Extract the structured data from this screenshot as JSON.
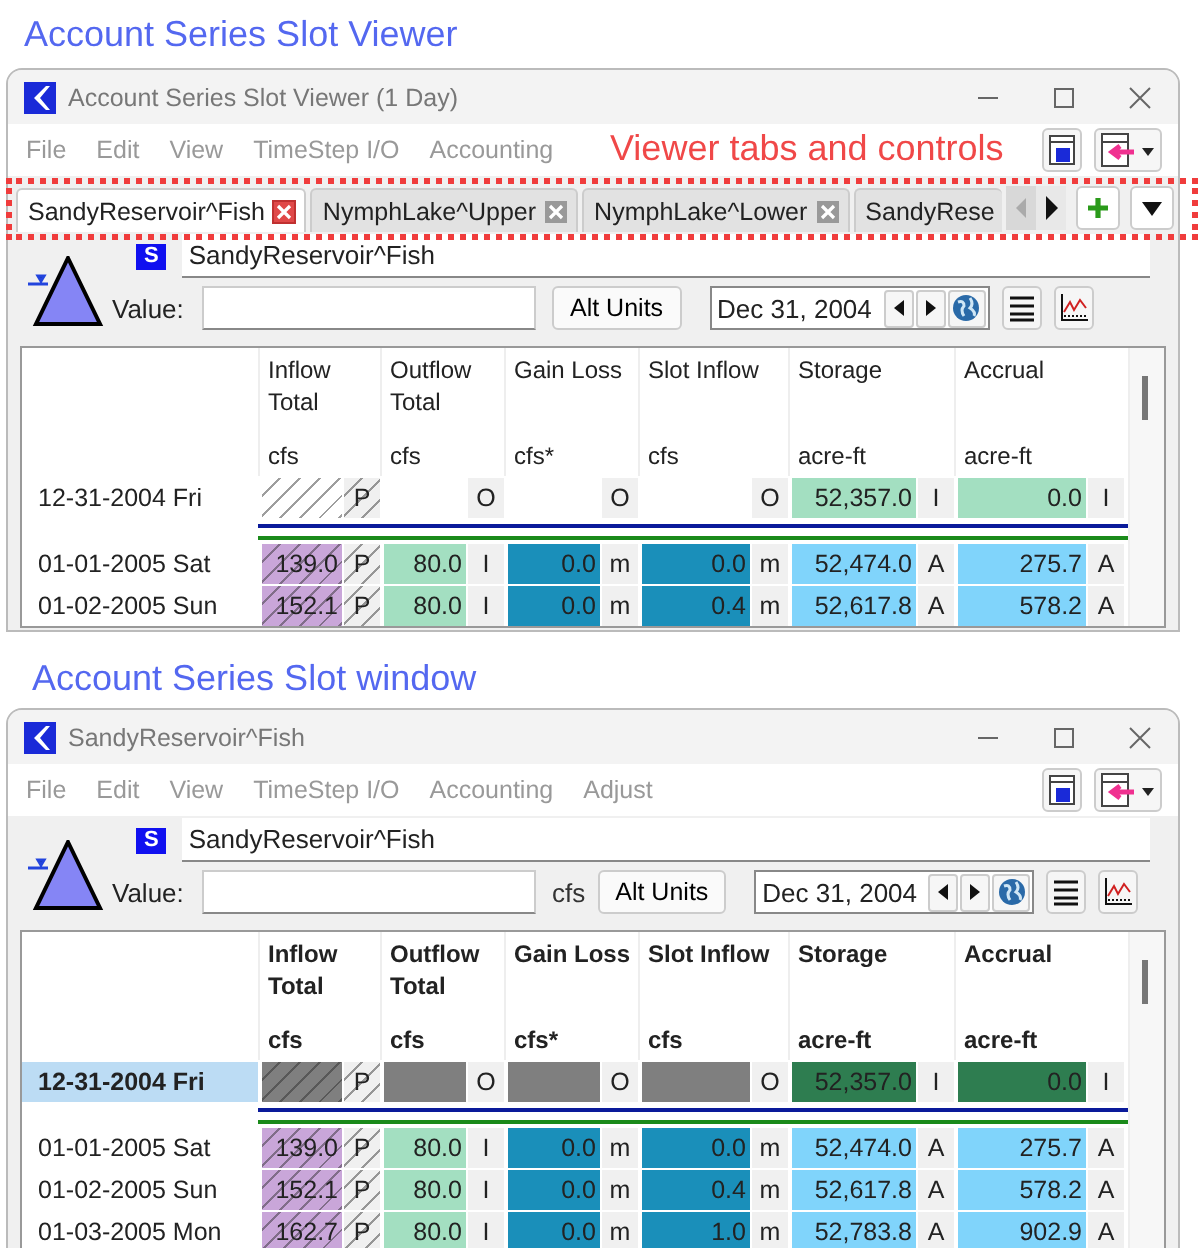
{
  "windows": [
    {
      "caption": "Account Series Slot Viewer",
      "title": "Account Series Slot Viewer (1 Day)",
      "menu": [
        "File",
        "Edit",
        "View",
        "TimeStep I/O",
        "Accounting"
      ],
      "callout": "Viewer tabs and controls",
      "tabs": [
        {
          "label": "SandyReservoir^Fish",
          "selected": true
        },
        {
          "label": "NymphLake^Upper",
          "selected": false
        },
        {
          "label": "NymphLake^Lower",
          "selected": false
        },
        {
          "label": "SandyRese",
          "selected": false
        }
      ],
      "badge": "S",
      "slot_name": "SandyReservoir^Fish",
      "value_label": "Value:",
      "alt_units": "Alt Units",
      "date": "Dec 31, 2004",
      "header_bold": false,
      "columns": [
        {
          "name": [
            "Inflow",
            "Total"
          ],
          "units": "cfs"
        },
        {
          "name": [
            "Outflow",
            "Total"
          ],
          "units": "cfs"
        },
        {
          "name": [
            "Gain Loss"
          ],
          "units": "cfs*"
        },
        {
          "name": [
            "Slot Inflow"
          ],
          "units": "cfs"
        },
        {
          "name": [
            "Storage"
          ],
          "units": "acre-ft"
        },
        {
          "name": [
            "Accrual"
          ],
          "units": "acre-ft"
        }
      ],
      "rows": [
        {
          "date": "12-31-2004 Fri",
          "selected": false,
          "cells": [
            {
              "flag": "P",
              "hatched": true
            },
            {
              "flag": "O",
              "hatched": false
            },
            {
              "flag": "O",
              "hatched": false
            },
            {
              "flag": "O",
              "hatched": false
            },
            {
              "value": "52,357.0",
              "flag": "I",
              "color": "#a3dfc1",
              "hatched": false
            },
            {
              "value": "0.0",
              "flag": "I",
              "color": "#a3dfc1",
              "hatched": false
            }
          ]
        },
        {
          "date": "01-01-2005 Sat",
          "selected": false,
          "cells": [
            {
              "value": "139.0",
              "flag": "P",
              "color": "#c9a6d9",
              "hatched": true
            },
            {
              "value": "80.0",
              "flag": "I",
              "color": "#a3dfc1",
              "hatched": false
            },
            {
              "value": "0.0",
              "flag": "m",
              "color": "#1a8fba",
              "hatched": false
            },
            {
              "value": "0.0",
              "flag": "m",
              "color": "#1a8fba",
              "hatched": false
            },
            {
              "value": "52,474.0",
              "flag": "A",
              "color": "#80d4fb",
              "hatched": false
            },
            {
              "value": "275.7",
              "flag": "A",
              "color": "#80d4fb",
              "hatched": false
            }
          ]
        },
        {
          "date": "01-02-2005 Sun",
          "selected": false,
          "cells": [
            {
              "value": "152.1",
              "flag": "P",
              "color": "#c9a6d9",
              "hatched": true
            },
            {
              "value": "80.0",
              "flag": "I",
              "color": "#a3dfc1",
              "hatched": false
            },
            {
              "value": "0.0",
              "flag": "m",
              "color": "#1a8fba",
              "hatched": false
            },
            {
              "value": "0.4",
              "flag": "m",
              "color": "#1a8fba",
              "hatched": false
            },
            {
              "value": "52,617.8",
              "flag": "A",
              "color": "#80d4fb",
              "hatched": false
            },
            {
              "value": "578.2",
              "flag": "A",
              "color": "#80d4fb",
              "hatched": false
            }
          ]
        }
      ]
    },
    {
      "caption": "Account Series Slot window",
      "title": "SandyReservoir^Fish",
      "menu": [
        "File",
        "Edit",
        "View",
        "TimeStep I/O",
        "Accounting",
        "Adjust"
      ],
      "badge": "S",
      "slot_name": "SandyReservoir^Fish",
      "value_label": "Value:",
      "units": "cfs",
      "alt_units": "Alt Units",
      "date": "Dec 31, 2004",
      "header_bold": true,
      "columns": [
        {
          "name": [
            "Inflow",
            "Total"
          ],
          "units": "cfs"
        },
        {
          "name": [
            "Outflow",
            "Total"
          ],
          "units": "cfs"
        },
        {
          "name": [
            "Gain Loss"
          ],
          "units": "cfs*"
        },
        {
          "name": [
            "Slot Inflow"
          ],
          "units": "cfs"
        },
        {
          "name": [
            "Storage"
          ],
          "units": "acre-ft"
        },
        {
          "name": [
            "Accrual"
          ],
          "units": "acre-ft"
        }
      ],
      "rows": [
        {
          "date": "12-31-2004 Fri",
          "selected": true,
          "cells": [
            {
              "flag": "P",
              "color": "#7f7f7f",
              "hatched": true
            },
            {
              "flag": "O",
              "color": "#7f7f7f",
              "hatched": false
            },
            {
              "flag": "O",
              "color": "#7f7f7f",
              "hatched": false
            },
            {
              "flag": "O",
              "color": "#7f7f7f",
              "hatched": false
            },
            {
              "value": "52,357.0",
              "flag": "I",
              "color": "#2e7d50",
              "hatched": false
            },
            {
              "value": "0.0",
              "flag": "I",
              "color": "#2e7d50",
              "hatched": false
            }
          ]
        },
        {
          "date": "01-01-2005 Sat",
          "selected": false,
          "cells": [
            {
              "value": "139.0",
              "flag": "P",
              "color": "#c9a6d9",
              "hatched": true
            },
            {
              "value": "80.0",
              "flag": "I",
              "color": "#a3dfc1",
              "hatched": false
            },
            {
              "value": "0.0",
              "flag": "m",
              "color": "#1a8fba",
              "hatched": false
            },
            {
              "value": "0.0",
              "flag": "m",
              "color": "#1a8fba",
              "hatched": false
            },
            {
              "value": "52,474.0",
              "flag": "A",
              "color": "#80d4fb",
              "hatched": false
            },
            {
              "value": "275.7",
              "flag": "A",
              "color": "#80d4fb",
              "hatched": false
            }
          ]
        },
        {
          "date": "01-02-2005 Sun",
          "selected": false,
          "cells": [
            {
              "value": "152.1",
              "flag": "P",
              "color": "#c9a6d9",
              "hatched": true
            },
            {
              "value": "80.0",
              "flag": "I",
              "color": "#a3dfc1",
              "hatched": false
            },
            {
              "value": "0.0",
              "flag": "m",
              "color": "#1a8fba",
              "hatched": false
            },
            {
              "value": "0.4",
              "flag": "m",
              "color": "#1a8fba",
              "hatched": false
            },
            {
              "value": "52,617.8",
              "flag": "A",
              "color": "#80d4fb",
              "hatched": false
            },
            {
              "value": "578.2",
              "flag": "A",
              "color": "#80d4fb",
              "hatched": false
            }
          ]
        },
        {
          "date": "01-03-2005 Mon",
          "selected": false,
          "cells": [
            {
              "value": "162.7",
              "flag": "P",
              "color": "#c9a6d9",
              "hatched": true
            },
            {
              "value": "80.0",
              "flag": "I",
              "color": "#a3dfc1",
              "hatched": false
            },
            {
              "value": "0.0",
              "flag": "m",
              "color": "#1a8fba",
              "hatched": false
            },
            {
              "value": "1.0",
              "flag": "m",
              "color": "#1a8fba",
              "hatched": false
            },
            {
              "value": "52,783.8",
              "flag": "A",
              "color": "#80d4fb",
              "hatched": false
            },
            {
              "value": "902.9",
              "flag": "A",
              "color": "#80d4fb",
              "hatched": false
            }
          ]
        }
      ]
    }
  ]
}
